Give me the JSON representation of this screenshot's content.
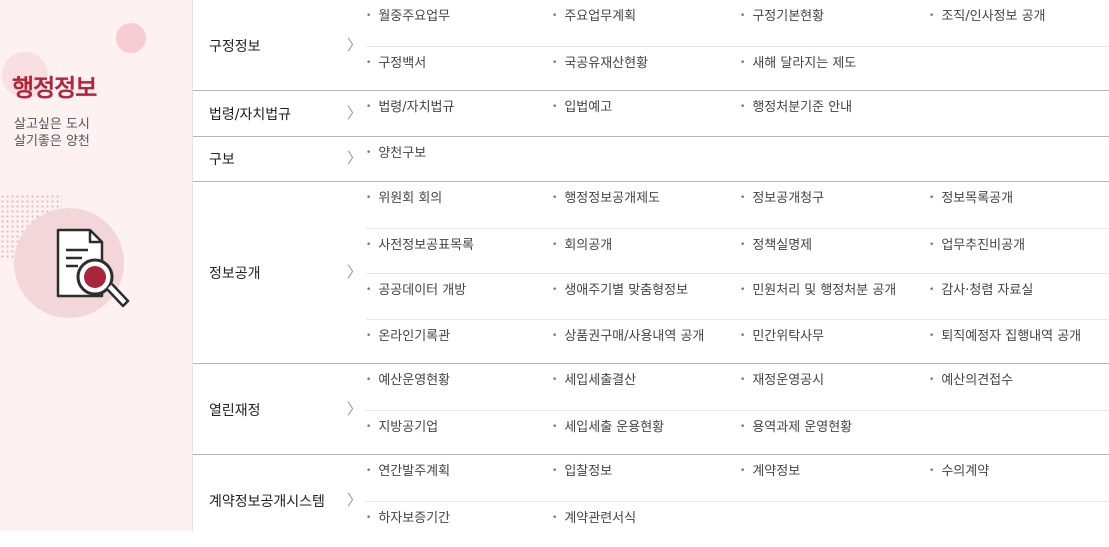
{
  "section": {
    "title": "행정정보",
    "slogan_line1": "살고싶은 도시",
    "slogan_line2": "살기좋은 양천"
  },
  "icon": {
    "name": "document-search-icon",
    "accent": "#a8253a",
    "stroke": "#2d2d2d"
  },
  "colors": {
    "title": "#b2243a",
    "panel_bg": "#fdf1f2"
  },
  "categories": [
    {
      "label": "구정정보",
      "rows": [
        [
          "월중주요업무",
          "주요업무계획",
          "구정기본현황",
          "조직/인사정보 공개"
        ],
        [
          "구정백서",
          "국공유재산현황",
          "새해 달라지는 제도"
        ]
      ]
    },
    {
      "label": "법령/자치법규",
      "rows": [
        [
          "법령/자치법규",
          "입법예고",
          "행정처분기준 안내"
        ]
      ]
    },
    {
      "label": "구보",
      "rows": [
        [
          "양천구보"
        ]
      ]
    },
    {
      "label": "정보공개",
      "rows": [
        [
          "위원회 회의",
          "행정정보공개제도",
          "정보공개청구",
          "정보목록공개"
        ],
        [
          "사전정보공표목록",
          "회의공개",
          "정책실명제",
          "업무추진비공개"
        ],
        [
          "공공데이터 개방",
          "생애주기별 맞춤형정보",
          "민원처리 및 행정처분 공개",
          "감사·청렴 자료실"
        ],
        [
          "온라인기록관",
          "상품권구매/사용내역 공개",
          "민간위탁사무",
          "퇴직예정자 집행내역 공개"
        ]
      ]
    },
    {
      "label": "열린재정",
      "rows": [
        [
          "예산운영현황",
          "세입세출결산",
          "재정운영공시",
          "예산의견접수"
        ],
        [
          "지방공기업",
          "세입세출 운용현황",
          "용역과제 운영현황"
        ]
      ]
    },
    {
      "label": "계약정보공개시스템",
      "rows": [
        [
          "연간발주계획",
          "입찰정보",
          "계약정보",
          "수의계약"
        ],
        [
          "하자보증기간",
          "계약관련서식"
        ]
      ]
    }
  ]
}
